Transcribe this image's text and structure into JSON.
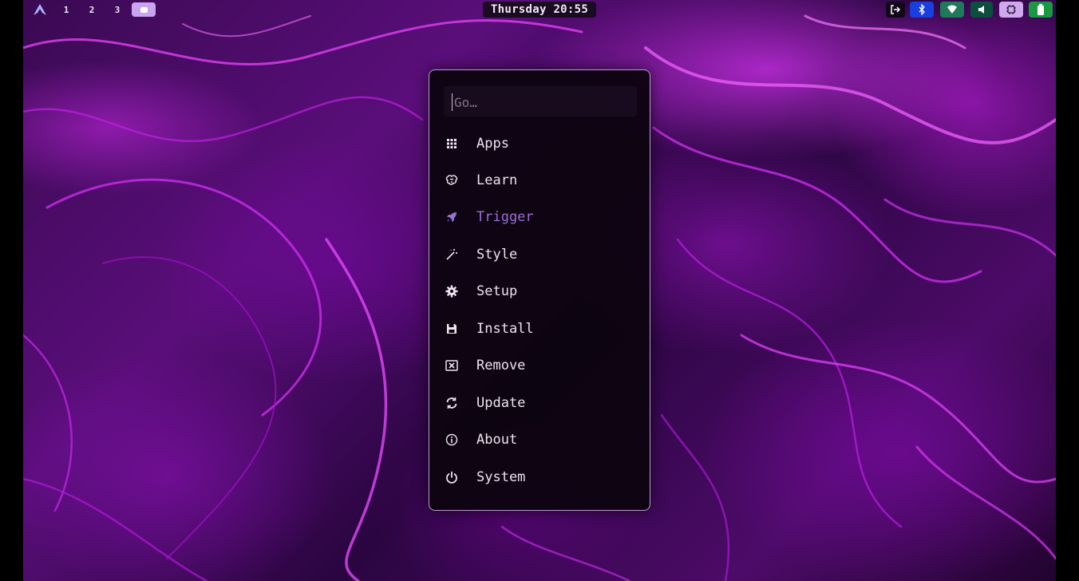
{
  "workspaces": [
    "1",
    "2",
    "3"
  ],
  "clock": "Thursday 20:55",
  "tray_icons": [
    "logout-icon",
    "bluetooth-icon",
    "wifi-icon",
    "volume-icon",
    "cpu-icon",
    "battery-icon"
  ],
  "colors": {
    "bluetooth": "#1a3fe0",
    "wifi": "#1f7a5a",
    "volume": "#0d4f3e",
    "cpu": "#cfa8ee",
    "battery": "#1a9a40",
    "workspace_active": "#c9a4f0",
    "highlight": "#9b6fd6"
  },
  "launcher": {
    "search_placeholder": "Go…",
    "items": [
      {
        "label": "Apps",
        "icon": "grid-icon"
      },
      {
        "label": "Learn",
        "icon": "brain-icon"
      },
      {
        "label": "Trigger",
        "icon": "rocket-icon"
      },
      {
        "label": "Style",
        "icon": "magic-wand-icon"
      },
      {
        "label": "Setup",
        "icon": "gear-icon"
      },
      {
        "label": "Install",
        "icon": "save-icon"
      },
      {
        "label": "Remove",
        "icon": "remove-box-icon"
      },
      {
        "label": "Update",
        "icon": "refresh-icon"
      },
      {
        "label": "About",
        "icon": "info-icon"
      },
      {
        "label": "System",
        "icon": "power-icon"
      }
    ]
  }
}
